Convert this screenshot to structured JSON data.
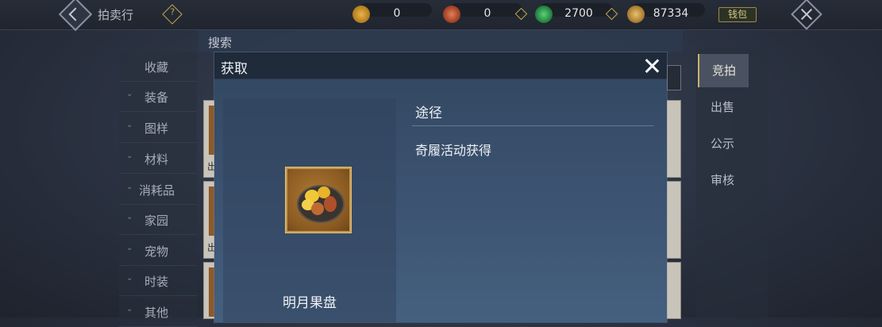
{
  "topbar": {
    "title": "拍卖行",
    "help_label": "?",
    "currencies": [
      {
        "icon": "gold-ingot-icon",
        "value": "0"
      },
      {
        "icon": "copper-coin-icon",
        "value": "0"
      },
      {
        "icon": "jade-coin-icon",
        "value": "2700"
      },
      {
        "icon": "gold-ingot-stack-icon",
        "value": "87334"
      }
    ],
    "wallet_label": "钱包"
  },
  "sidebar": {
    "items": [
      {
        "label": "收藏",
        "arrow": ""
      },
      {
        "label": "装备",
        "arrow": "⌄"
      },
      {
        "label": "图样",
        "arrow": "⌄"
      },
      {
        "label": "材料",
        "arrow": "⌄"
      },
      {
        "label": "消耗品",
        "arrow": "⌄"
      },
      {
        "label": "家园",
        "arrow": "⌄"
      },
      {
        "label": "宠物",
        "arrow": "⌄"
      },
      {
        "label": "时装",
        "arrow": "⌄"
      },
      {
        "label": "其他",
        "arrow": "⌄"
      }
    ]
  },
  "search": {
    "label": "搜索"
  },
  "background_list": {
    "tag": "出"
  },
  "right_tabs": [
    {
      "label": "竞拍",
      "active": true
    },
    {
      "label": "出售",
      "active": false
    },
    {
      "label": "公示",
      "active": false
    },
    {
      "label": "审核",
      "active": false
    }
  ],
  "modal": {
    "title": "获取",
    "item_name": "明月果盘",
    "route_title": "途径",
    "routes": [
      "奇履活动获得"
    ]
  },
  "colors": {
    "accent_gold": "#c9a94a",
    "modal_header": "#1f2a3a",
    "active_tab": "#4a5262"
  }
}
